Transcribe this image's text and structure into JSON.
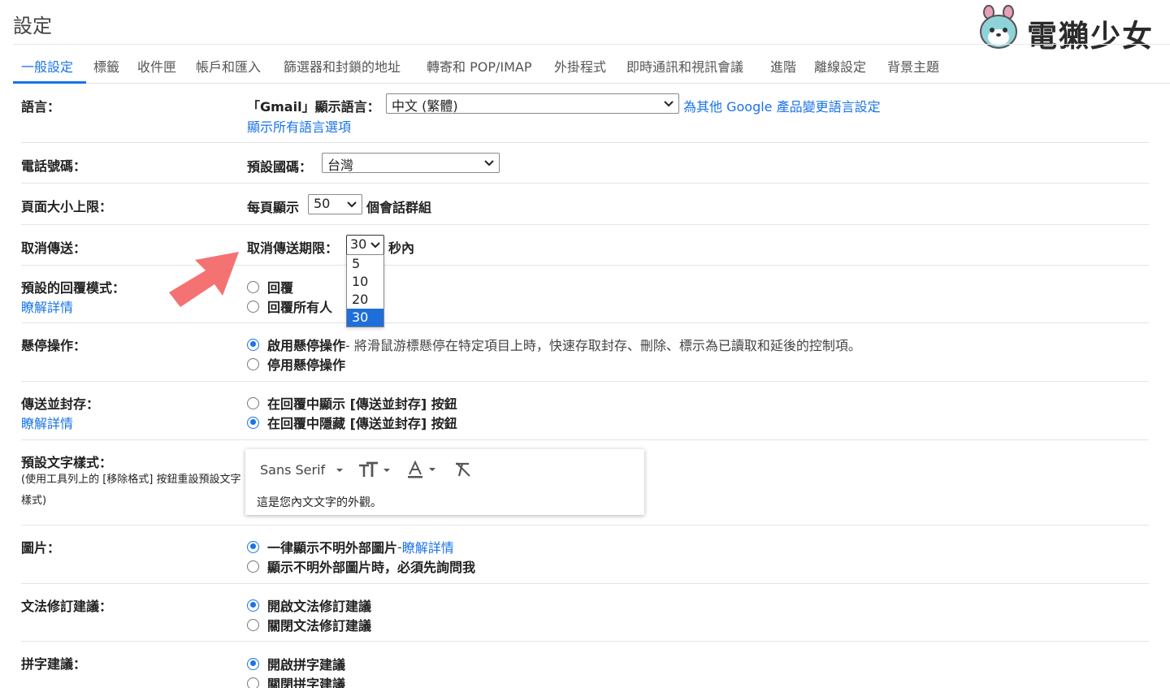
{
  "page": {
    "title": "設定"
  },
  "logo": {
    "text": "電獺少女"
  },
  "tabs": [
    {
      "label": "一般設定",
      "active": true
    },
    {
      "label": "標籤"
    },
    {
      "label": "收件匣"
    },
    {
      "label": "帳戶和匯入"
    },
    {
      "label": "篩選器和封鎖的地址"
    },
    {
      "label": "轉寄和 POP/IMAP"
    },
    {
      "label": "外掛程式"
    },
    {
      "label": "即時通訊和視訊會議"
    },
    {
      "label": "進階"
    },
    {
      "label": "離線設定"
    },
    {
      "label": "背景主題"
    }
  ],
  "language": {
    "label": "語言：",
    "display_label": "「Gmail」顯示語言：",
    "selected": "中文 (繁體)",
    "other_products_link": "為其他 Google 產品變更語言設定",
    "show_all_link": "顯示所有語言選項"
  },
  "phone": {
    "label": "電話號碼：",
    "country_label": "預設國碼：",
    "selected": "台灣"
  },
  "page_size": {
    "label": "頁面大小上限：",
    "prefix": "每頁顯示",
    "selected": "50",
    "suffix": "個會話群組"
  },
  "undo_send": {
    "label": "取消傳送：",
    "period_label": "取消傳送期限：",
    "selected": "30",
    "suffix": "秒內",
    "options": [
      "5",
      "10",
      "20",
      "30"
    ]
  },
  "reply_mode": {
    "label": "預設的回覆模式：",
    "learn_more": "瞭解詳情",
    "options": [
      "回覆",
      "回覆所有人"
    ]
  },
  "hover": {
    "label": "懸停操作：",
    "enable": "啟用懸停操作",
    "enable_desc": " - 將滑鼠游標懸停在特定項目上時，快速存取封存、刪除、標示為已讀取和延後的控制項。",
    "disable": "停用懸停操作"
  },
  "send_archive": {
    "label": "傳送並封存：",
    "learn_more": "瞭解詳情",
    "show": "在回覆中顯示 [傳送並封存] 按鈕",
    "hide": "在回覆中隱藏 [傳送並封存] 按鈕"
  },
  "text_style": {
    "label": "預設文字樣式：",
    "note": "(使用工具列上的 [移除格式] 按鈕重設預設文字樣式)",
    "font": "Sans Serif",
    "sample": "這是您內文文字的外觀。"
  },
  "images": {
    "label": "圖片：",
    "always": "一律顯示不明外部圖片",
    "always_sep": " - ",
    "learn_more": "瞭解詳情",
    "ask": "顯示不明外部圖片時，必須先詢問我"
  },
  "grammar": {
    "label": "文法修訂建議：",
    "on": "開啟文法修訂建議",
    "off": "關閉文法修訂建議"
  },
  "spelling": {
    "label": "拼字建議：",
    "on": "開啟拼字建議",
    "off": "關閉拼字建議"
  },
  "colors": {
    "accent": "#1a73e8",
    "arrow": "#f47272"
  }
}
